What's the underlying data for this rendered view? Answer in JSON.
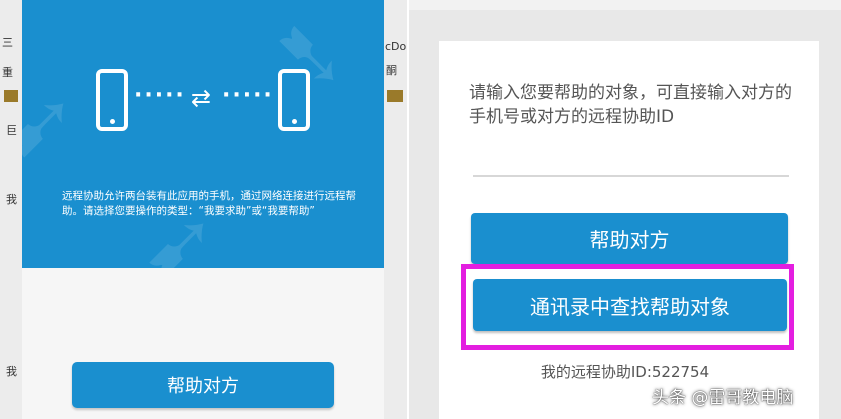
{
  "left": {
    "description": "远程协助允许两台装有此应用的手机，通过网络连接进行远程帮助。请选择您要操作的类型：“我要求助”或“我要帮助”",
    "help_button": "帮助对方",
    "dots": "·····",
    "edge_fragments": {
      "a": "三",
      "b": "重",
      "c": "巨",
      "d": "我",
      "e": "我",
      "f": "cDo",
      "g": "酮"
    }
  },
  "right": {
    "prompt": "请输入您要帮助的对象，可直接输入对方的手机号或对方的远程协助ID",
    "help_button": "帮助对方",
    "contacts_button": "通讯录中查找帮助对象",
    "my_id": "我的远程协助ID:522754",
    "highlight_color": "#e31ee0"
  },
  "watermark": "头条 @雷哥教电脑",
  "colors": {
    "accent": "#1a8fcf",
    "highlight": "#e31ee0"
  },
  "icons": {
    "phone": "phone-icon",
    "swap": "swap-arrows-icon"
  }
}
